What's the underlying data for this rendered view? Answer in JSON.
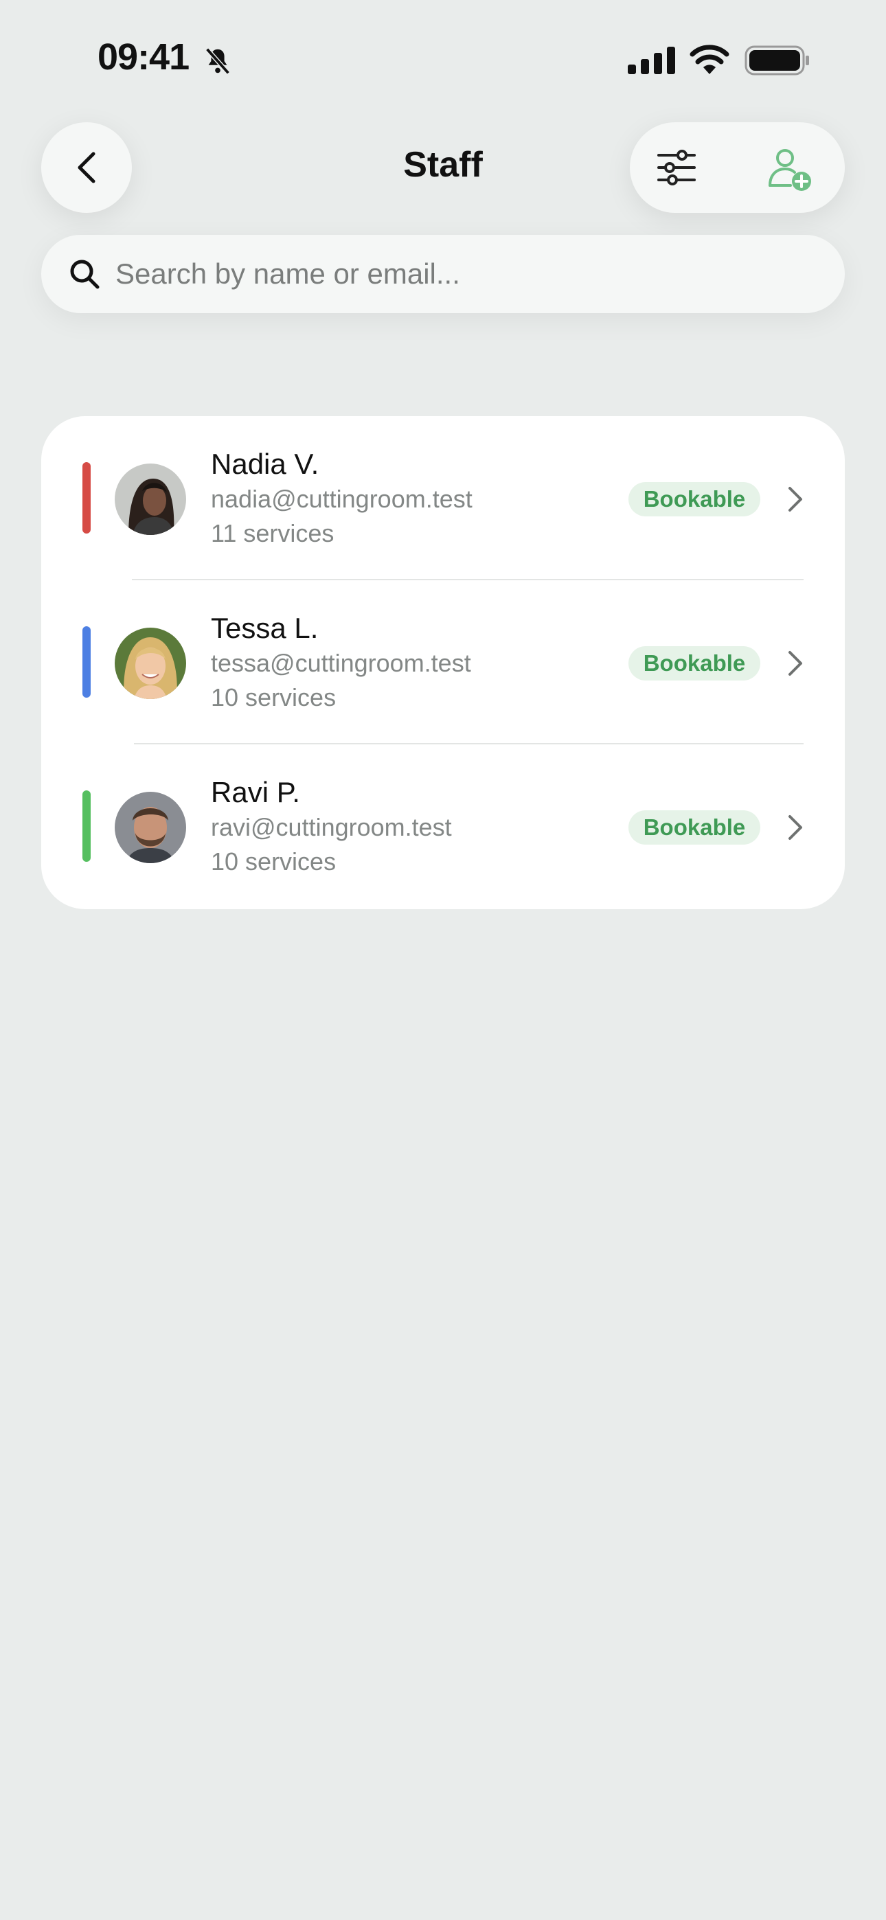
{
  "status_bar": {
    "time": "09:41",
    "icons": [
      "bell-slash-icon",
      "cellular-signal-icon",
      "wifi-icon",
      "battery-icon"
    ]
  },
  "header": {
    "title": "Staff",
    "back_icon": "chevron-left-icon",
    "filter_icon": "sliders-icon",
    "add_icon": "user-plus-icon"
  },
  "search": {
    "placeholder": "Search by name or email...",
    "value": ""
  },
  "staff": [
    {
      "name": "Nadia V.",
      "email": "nadia@cuttingroom.test",
      "services": "11 services",
      "status": "Bookable",
      "color": "#d64b45"
    },
    {
      "name": "Tessa L.",
      "email": "tessa@cuttingroom.test",
      "services": "10 services",
      "status": "Bookable",
      "color": "#4d7fe3"
    },
    {
      "name": "Ravi P.",
      "email": "ravi@cuttingroom.test",
      "services": "10 services",
      "status": "Bookable",
      "color": "#55bf5f"
    }
  ],
  "colors": {
    "accent_green": "#3f9a55",
    "badge_bg": "#e6f3e8",
    "add_user_icon": "#6fbf86"
  }
}
